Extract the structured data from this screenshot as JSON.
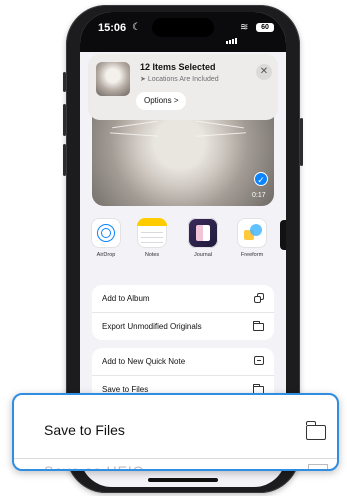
{
  "status_bar": {
    "time": "15:06",
    "battery": "60"
  },
  "share_header": {
    "title": "12 Items Selected",
    "subtitle": "Locations Are Included",
    "options_label": "Options",
    "options_chevron": ">"
  },
  "photo": {
    "duration": "0:17"
  },
  "apps": [
    {
      "label": "AirDrop",
      "icon": "airdrop-icon"
    },
    {
      "label": "Notes",
      "icon": "notes-icon"
    },
    {
      "label": "Journal",
      "icon": "journal-icon"
    },
    {
      "label": "Freeform",
      "icon": "freeform-icon"
    }
  ],
  "actions_group1": [
    {
      "label": "Add to Album",
      "icon": "album-icon"
    },
    {
      "label": "Export Unmodified Originals",
      "icon": "folder-icon"
    }
  ],
  "actions_group2": [
    {
      "label": "Add to New Quick Note",
      "icon": "quick-note-icon"
    },
    {
      "label": "Save to Files",
      "icon": "folder-icon"
    }
  ],
  "callout": {
    "label": "Save to Files",
    "next_label": "Save as HEIC",
    "border_color": "#2f8de4"
  }
}
